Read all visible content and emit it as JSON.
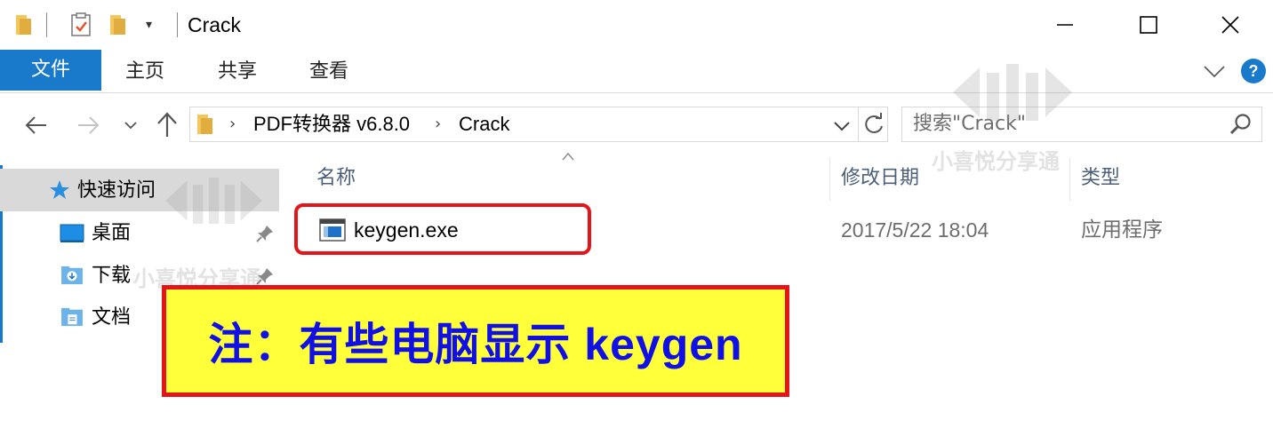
{
  "window": {
    "title": "Crack",
    "quick_access_dropdown": "▾"
  },
  "ribbon": {
    "tabs": [
      {
        "label": "文件",
        "active": true
      },
      {
        "label": "主页"
      },
      {
        "label": "共享"
      },
      {
        "label": "查看"
      }
    ],
    "help_label": "?"
  },
  "address_bar": {
    "segments": [
      "PDF转换器 v6.8.0",
      "Crack"
    ],
    "separator": "›"
  },
  "search": {
    "placeholder": "搜索\"Crack\""
  },
  "nav_pane": {
    "quick_access": "快速访问",
    "items": [
      {
        "label": "桌面",
        "icon": "desktop-icon",
        "pinned": true
      },
      {
        "label": "下载",
        "icon": "downloads-icon",
        "pinned": true
      },
      {
        "label": "文档",
        "icon": "documents-icon",
        "pinned": false
      }
    ]
  },
  "columns": {
    "name": "名称",
    "modified": "修改日期",
    "type": "类型"
  },
  "files": [
    {
      "name": "keygen.exe",
      "modified": "2017/5/22 18:04",
      "type": "应用程序",
      "icon": "exe-icon"
    }
  ],
  "annotation": {
    "text": "注：有些电脑显示 keygen"
  },
  "watermark": {
    "text": "小喜悦分享通"
  },
  "colors": {
    "accent": "#1979ca",
    "highlight_border": "#e4141b",
    "note_background": "#ffff3a",
    "note_text": "#1010e6"
  }
}
